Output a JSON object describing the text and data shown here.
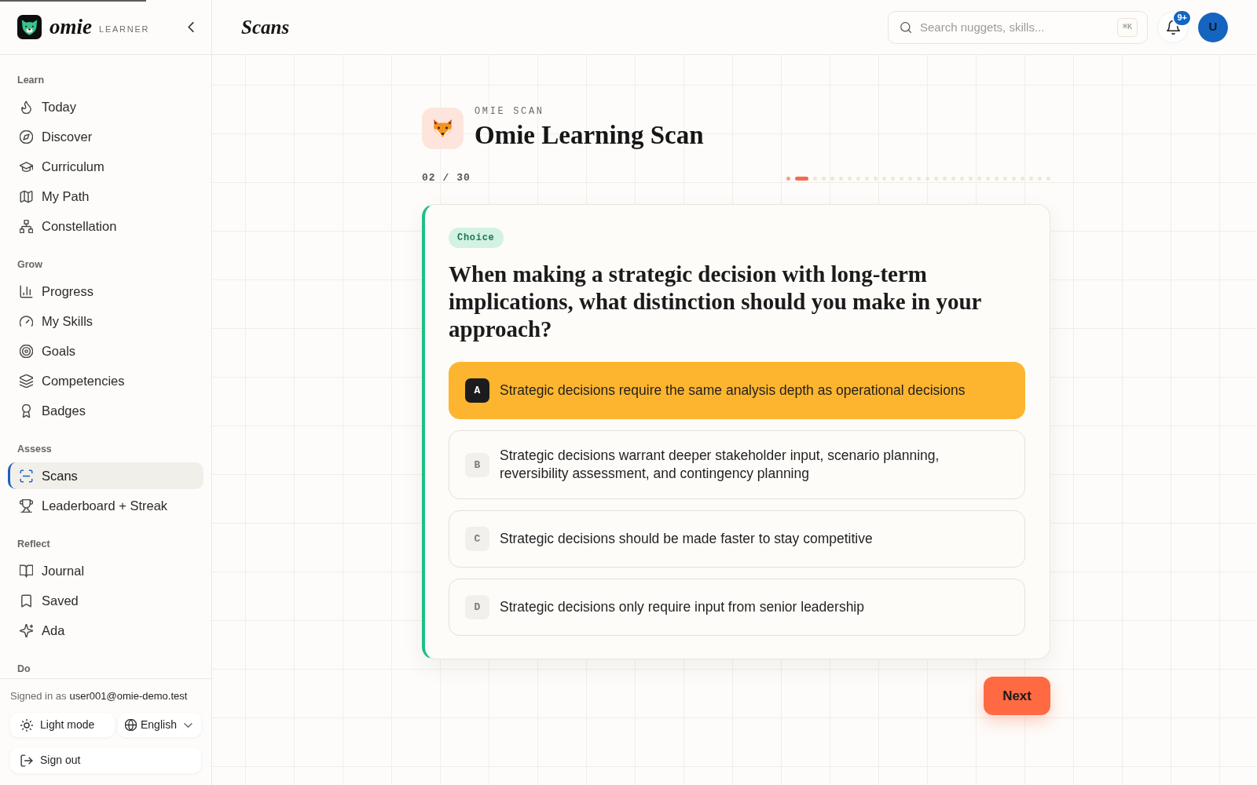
{
  "loading_bar": {
    "level": 0.116
  },
  "sidebar": {
    "brand": {
      "name": "omie",
      "subtitle": "LEARNER"
    },
    "sections": [
      {
        "label": "Learn",
        "items": [
          {
            "label": "Today",
            "selected": false
          },
          {
            "label": "Discover",
            "selected": false
          },
          {
            "label": "Curriculum",
            "selected": false
          },
          {
            "label": "My Path",
            "selected": false
          },
          {
            "label": "Constellation",
            "selected": false
          }
        ]
      },
      {
        "label": "Grow",
        "items": [
          {
            "label": "Progress",
            "selected": false
          },
          {
            "label": "My Skills",
            "selected": false
          },
          {
            "label": "Goals",
            "selected": false
          },
          {
            "label": "Competencies",
            "selected": false
          },
          {
            "label": "Badges",
            "selected": false
          }
        ]
      },
      {
        "label": "Assess",
        "items": [
          {
            "label": "Scans",
            "selected": true
          },
          {
            "label": "Leaderboard + Streak",
            "selected": false
          }
        ]
      },
      {
        "label": "Reflect",
        "items": [
          {
            "label": "Journal",
            "selected": false
          },
          {
            "label": "Saved",
            "selected": false
          },
          {
            "label": "Ada",
            "selected": false
          }
        ]
      },
      {
        "label": "Do"
      }
    ],
    "account": {
      "signed_in_label": "Signed in as",
      "email": "user001@omie-demo.test",
      "theme_button": "Light mode",
      "language": "English",
      "sign_out": "Sign out"
    }
  },
  "header": {
    "title": "Scans",
    "search": {
      "placeholder": "Search nuggets, skills...",
      "shortcut": "⌘K"
    },
    "notifications": {
      "count": "9+"
    },
    "avatar": {
      "initial": "U"
    }
  },
  "scan": {
    "eyebrow": "OMIE SCAN",
    "title": "Omie Learning Scan",
    "counter": "02 / 30",
    "steps": [
      {
        "done": true,
        "selected": false
      },
      {
        "done": false,
        "selected": true
      },
      {
        "done": false,
        "selected": false
      },
      {
        "done": false,
        "selected": false
      },
      {
        "done": false,
        "selected": false
      },
      {
        "done": false,
        "selected": false
      },
      {
        "done": false,
        "selected": false
      },
      {
        "done": false,
        "selected": false
      },
      {
        "done": false,
        "selected": false
      },
      {
        "done": false,
        "selected": false
      },
      {
        "done": false,
        "selected": false
      },
      {
        "done": false,
        "selected": false
      },
      {
        "done": false,
        "selected": false
      },
      {
        "done": false,
        "selected": false
      },
      {
        "done": false,
        "selected": false
      },
      {
        "done": false,
        "selected": false
      },
      {
        "done": false,
        "selected": false
      },
      {
        "done": false,
        "selected": false
      },
      {
        "done": false,
        "selected": false
      },
      {
        "done": false,
        "selected": false
      },
      {
        "done": false,
        "selected": false
      },
      {
        "done": false,
        "selected": false
      },
      {
        "done": false,
        "selected": false
      },
      {
        "done": false,
        "selected": false
      },
      {
        "done": false,
        "selected": false
      },
      {
        "done": false,
        "selected": false
      },
      {
        "done": false,
        "selected": false
      },
      {
        "done": false,
        "selected": false
      },
      {
        "done": false,
        "selected": false
      },
      {
        "done": false,
        "selected": false
      }
    ]
  },
  "question": {
    "tag": "Choice",
    "text": "When making a strategic decision with long-term implications, what distinction should you make in your approach?",
    "options": [
      {
        "letter": "A",
        "text": "Strategic decisions require the same analysis depth as operational decisions",
        "selected": true
      },
      {
        "letter": "B",
        "text": "Strategic decisions warrant deeper stakeholder input, scenario planning, reversibility assessment, and contingency planning",
        "selected": false
      },
      {
        "letter": "C",
        "text": "Strategic decisions should be made faster to stay competitive",
        "selected": false
      },
      {
        "letter": "D",
        "text": "Strategic decisions only require input from senior leadership",
        "selected": false
      }
    ]
  },
  "next_button": "Next"
}
